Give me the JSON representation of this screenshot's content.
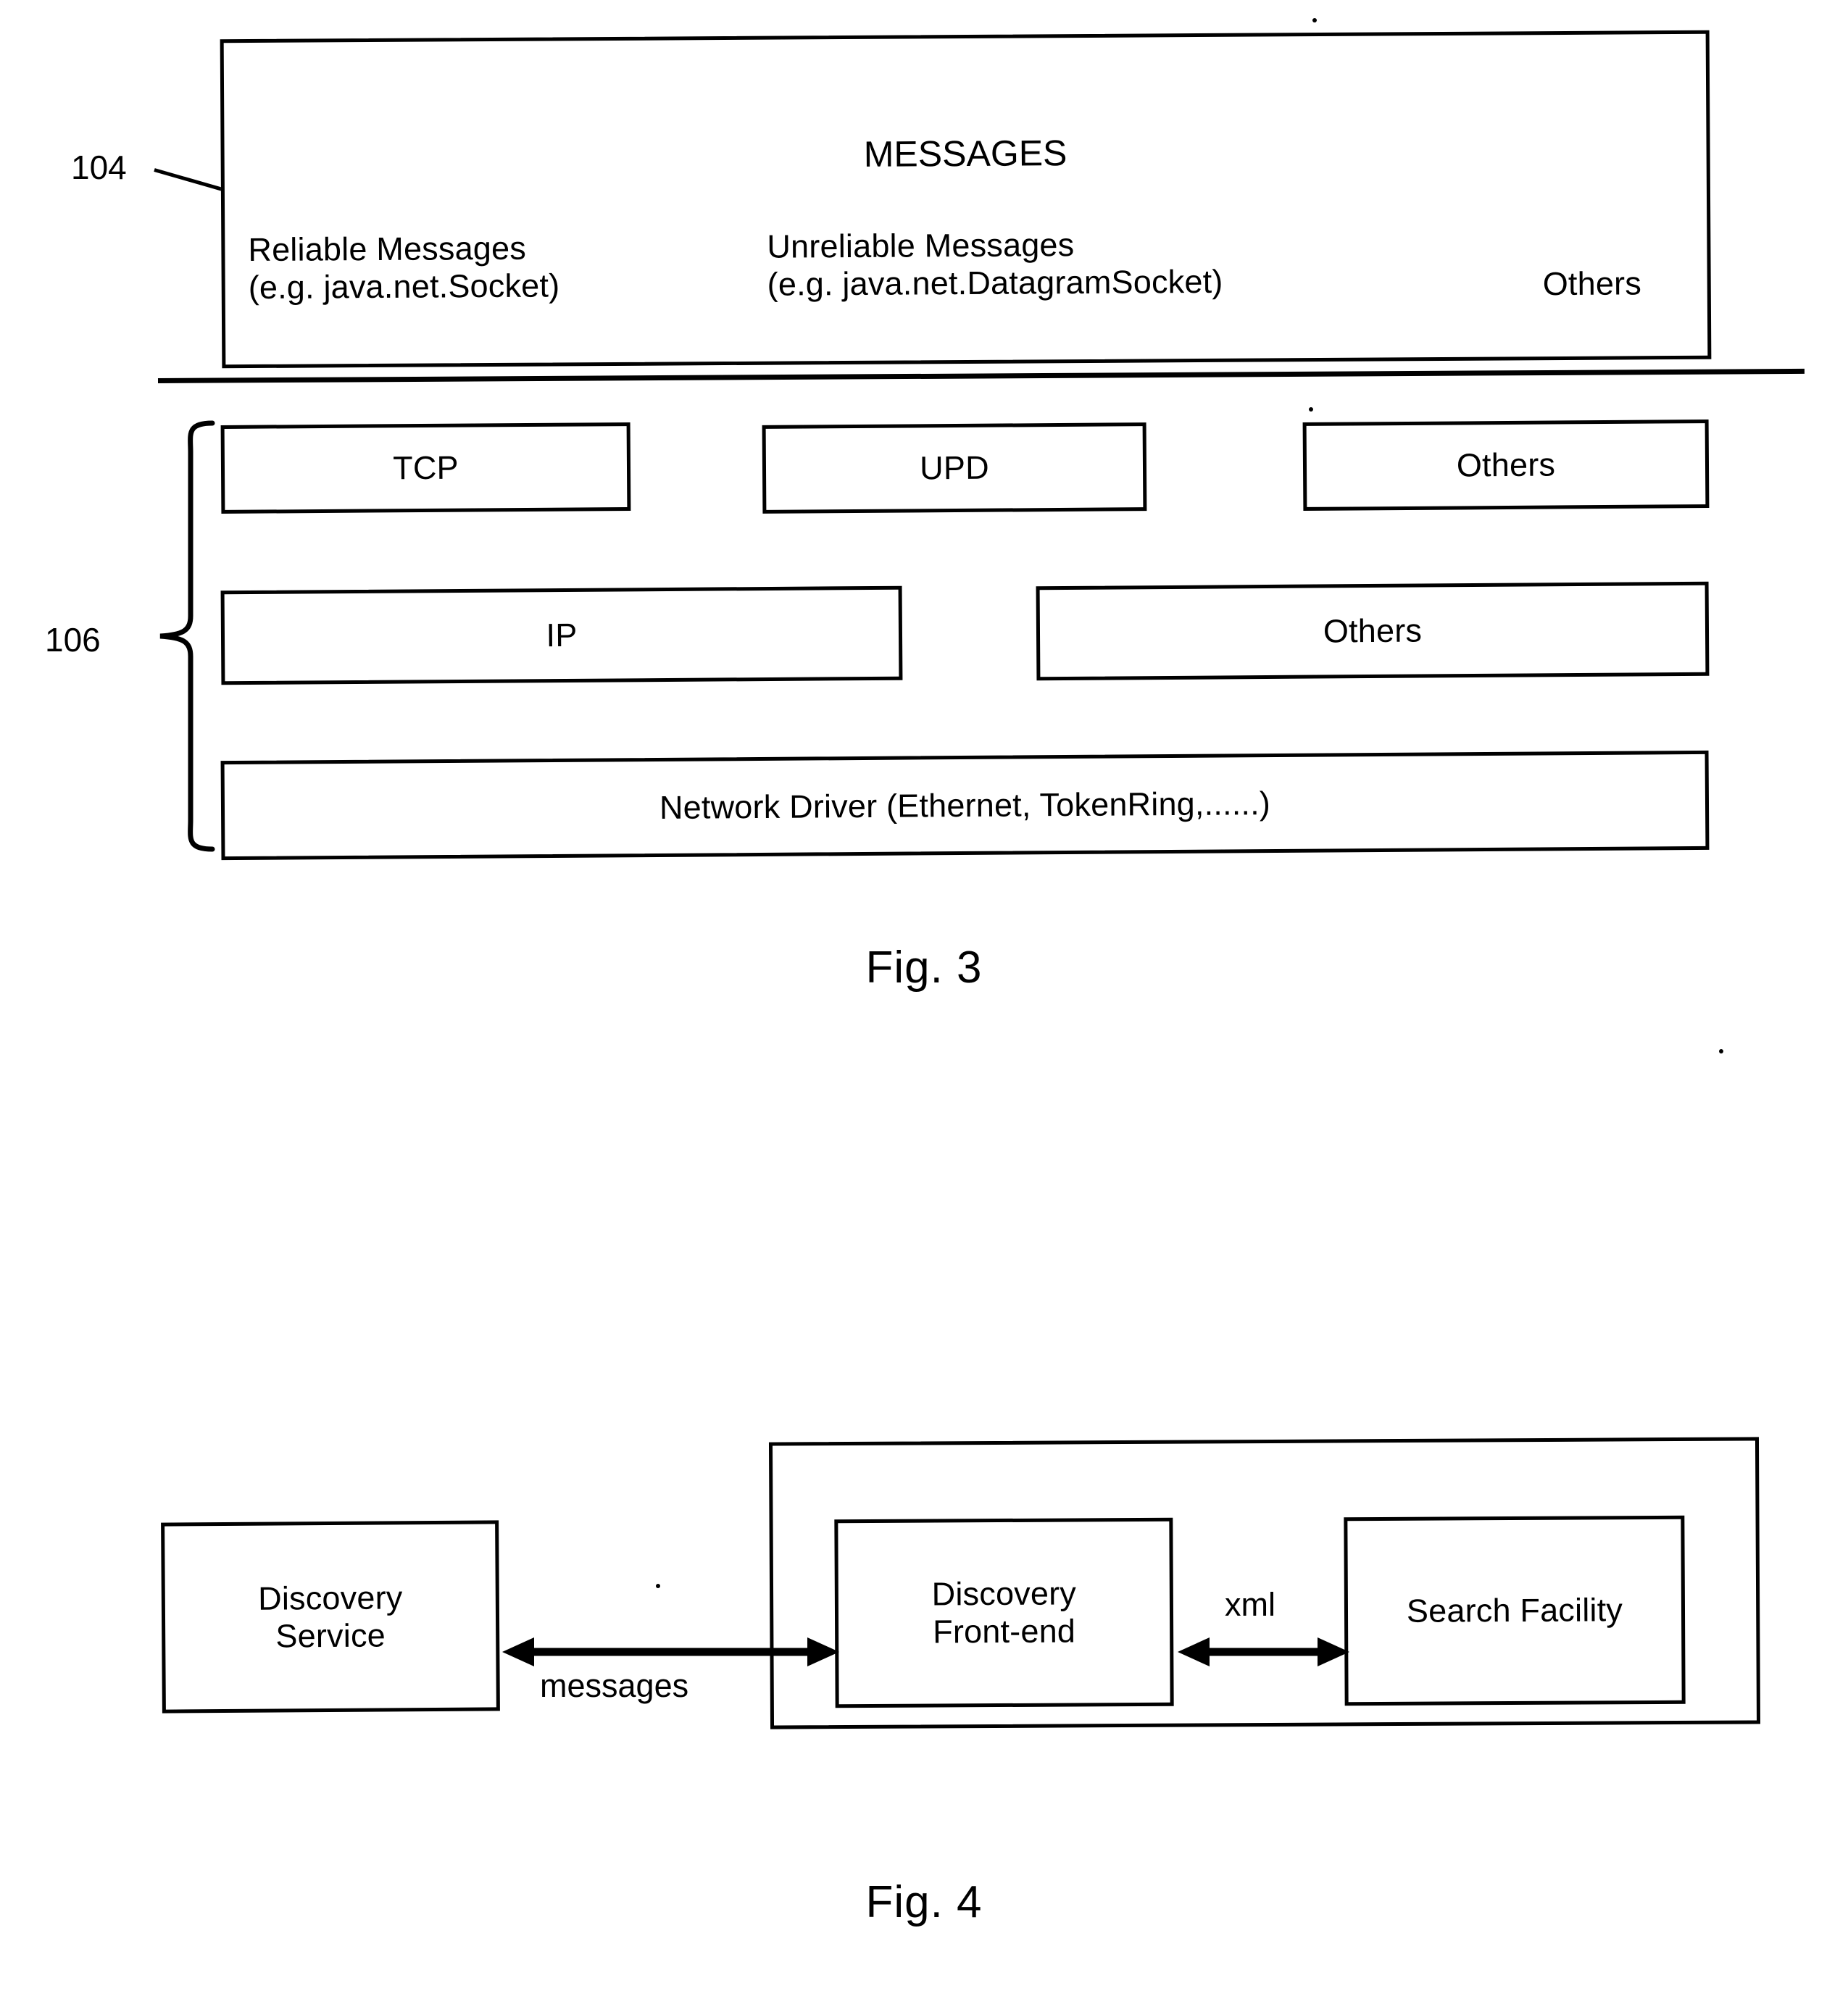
{
  "figures": [
    {
      "id": "fig3",
      "caption": "Fig. 3",
      "reference_numerals": [
        {
          "label": "104",
          "points_to": "messages-layer"
        },
        {
          "label": "106",
          "points_to": "transport-layer-group"
        }
      ],
      "messages_layer": {
        "title": "MESSAGES",
        "items": [
          {
            "name": "reliable-messages",
            "line1": "Reliable Messages",
            "line2": "(e.g. java.net.Socket)"
          },
          {
            "name": "unreliable-messages",
            "line1": "Unreliable Messages",
            "line2": "(e.g. java.net.DatagramSocket)"
          },
          {
            "name": "others-messages",
            "line1": "Others",
            "line2": ""
          }
        ]
      },
      "transport_layer": {
        "row1": [
          {
            "name": "tcp",
            "label": "TCP"
          },
          {
            "name": "upd",
            "label": "UPD"
          },
          {
            "name": "others-transport",
            "label": "Others"
          }
        ],
        "row2": [
          {
            "name": "ip",
            "label": "IP"
          },
          {
            "name": "others-network",
            "label": "Others"
          }
        ],
        "row3": [
          {
            "name": "network-driver",
            "label": "Network Driver (Ethernet, TokenRing,......)"
          }
        ]
      }
    },
    {
      "id": "fig4",
      "caption": "Fig. 4",
      "nodes": [
        {
          "name": "discovery-service",
          "line1": "Discovery",
          "line2": "Service"
        },
        {
          "name": "discovery-front-end",
          "line1": "Discovery",
          "line2": "Front-end"
        },
        {
          "name": "search-facility",
          "line1": "Search Facility",
          "line2": ""
        }
      ],
      "connections": [
        {
          "name": "messages-link",
          "label": "messages",
          "from": "discovery-service",
          "to": "discovery-front-end",
          "style": "double-arrow"
        },
        {
          "name": "xml-link",
          "label": "xml",
          "from": "discovery-front-end",
          "to": "search-facility",
          "style": "double-arrow"
        }
      ]
    }
  ],
  "colors": {
    "ink": "#000000",
    "paper": "#ffffff"
  }
}
